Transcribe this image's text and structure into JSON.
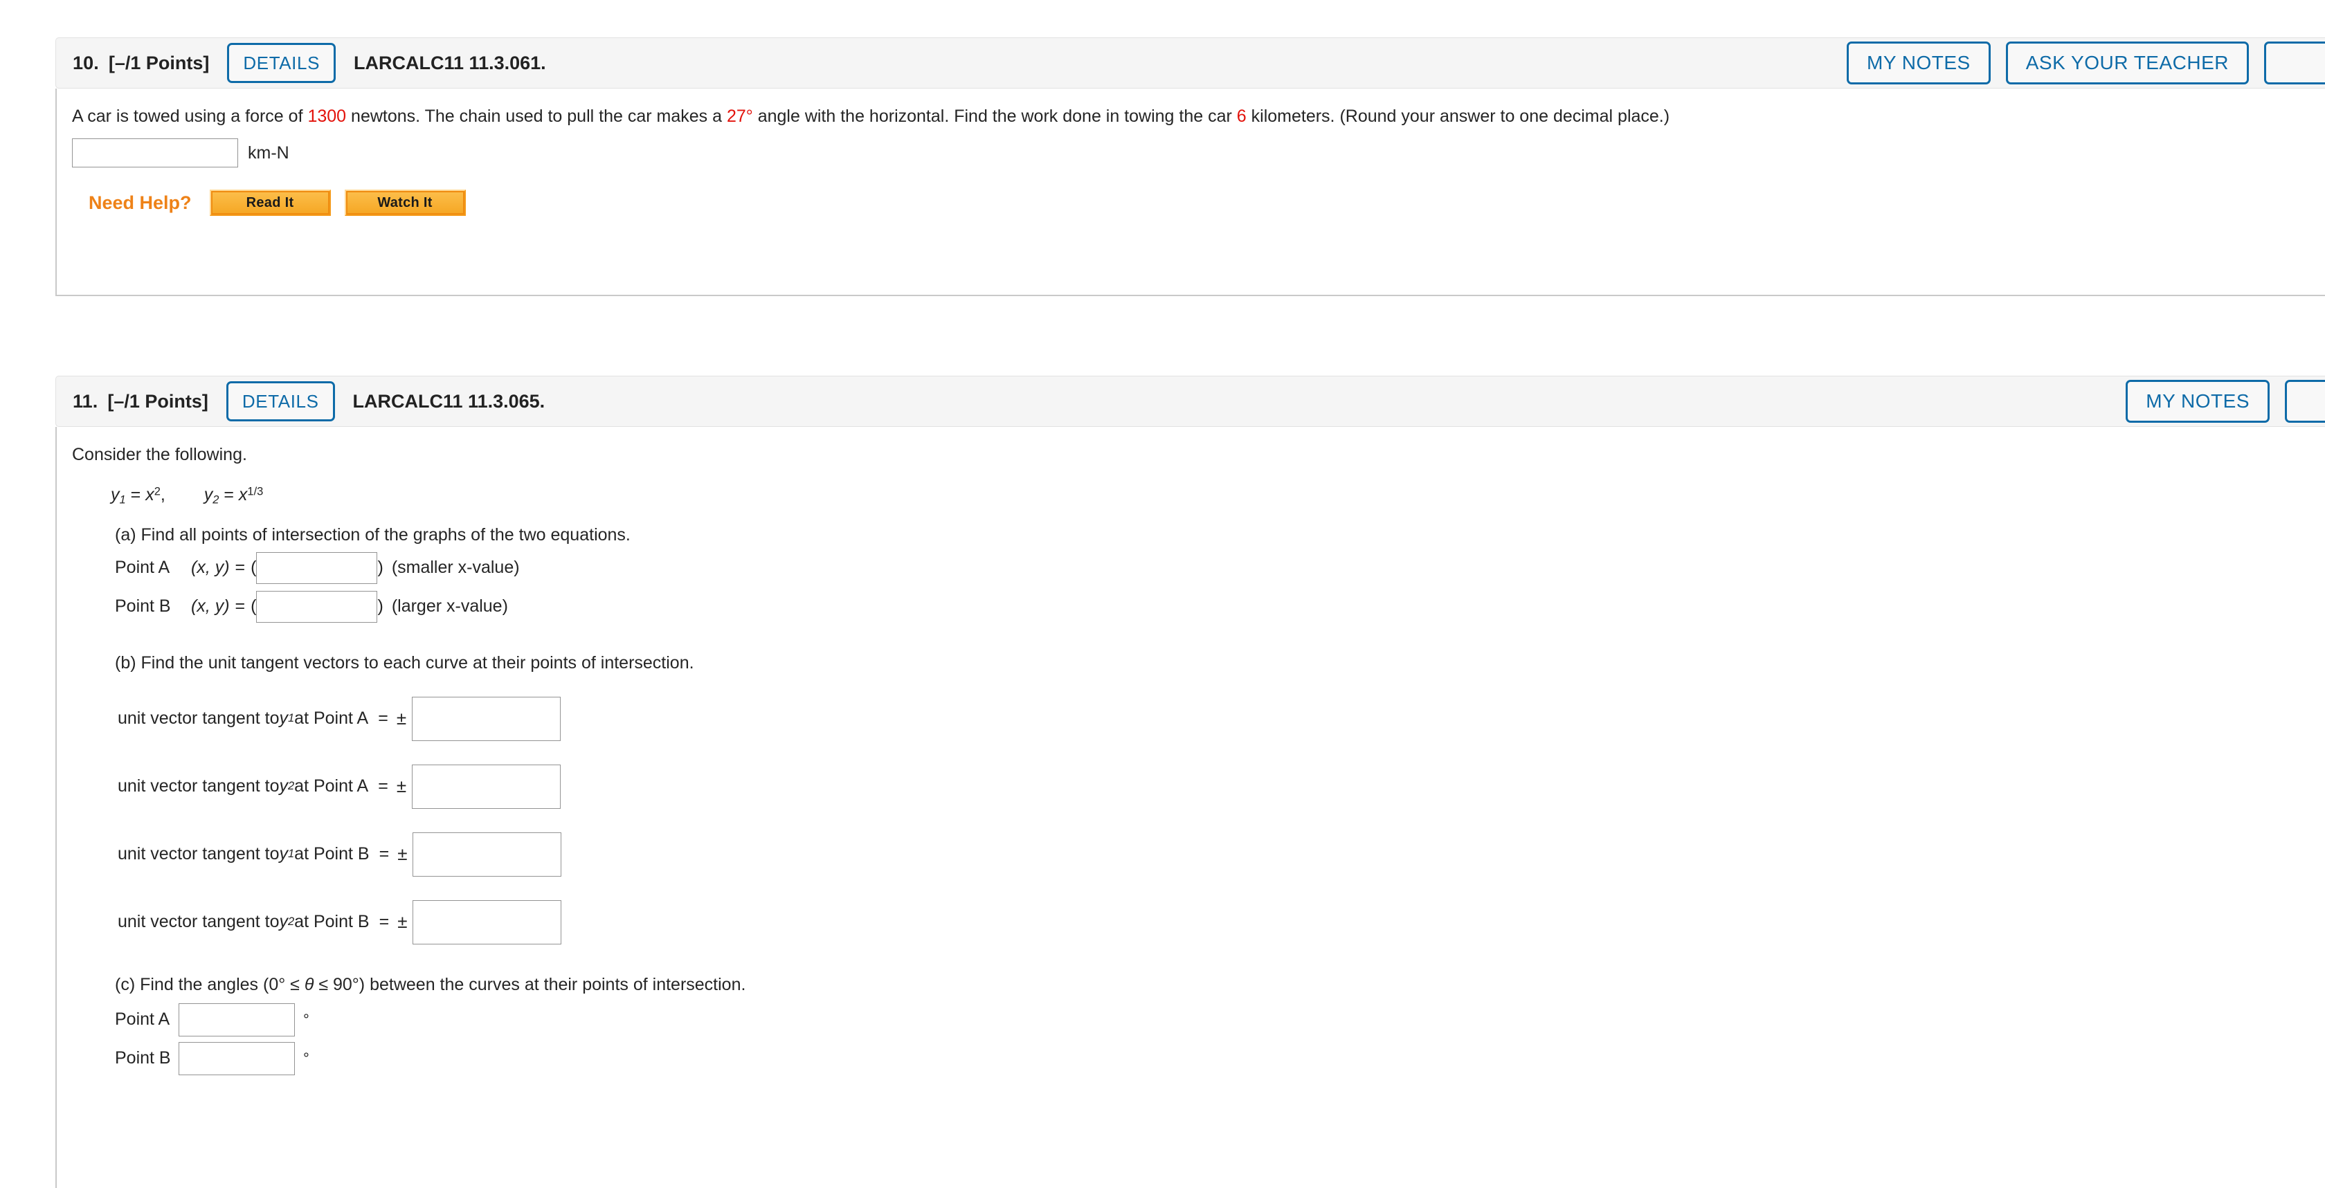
{
  "questions": [
    {
      "number": "10.",
      "points": "[–/1 Points]",
      "details_label": "DETAILS",
      "code": "LARCALC11 11.3.061.",
      "header_buttons": [
        "MY NOTES",
        "ASK YOUR TEACHER"
      ],
      "prompt": {
        "seg1": "A car is towed using a force of ",
        "force": "1300",
        "seg2": " newtons. The chain used to pull the car makes a ",
        "angle": "27°",
        "seg3": " angle with the horizontal. Find the work done in towing the car ",
        "distance": "6",
        "seg4": " kilometers. (Round your answer to one decimal place.)"
      },
      "answer_unit": "km-N",
      "answer_value": "",
      "need_help_label": "Need Help?",
      "help_buttons": [
        "Read It",
        "Watch It"
      ]
    },
    {
      "number": "11.",
      "points": "[–/1 Points]",
      "details_label": "DETAILS",
      "code": "LARCALC11 11.3.065.",
      "header_buttons": [
        "MY NOTES"
      ],
      "intro": "Consider the following.",
      "equations": {
        "y1_lhs": "y",
        "y1_sub": "1",
        "y1_eq": " = ",
        "y1_base": "x",
        "y1_exp": "2",
        "comma": ",",
        "y2_lhs": "y",
        "y2_sub": "2",
        "y2_eq": " = ",
        "y2_base": "x",
        "y2_exp": "1/3"
      },
      "part_a": {
        "label": "(a) Find all points of intersection of the graphs of the two equations.",
        "rows": [
          {
            "name": "Point A",
            "coord": "(x, y)",
            "equals": "=",
            "open": "(",
            "close": ")",
            "value": "",
            "suffix": "(smaller x-value)"
          },
          {
            "name": "Point B",
            "coord": "(x, y)",
            "equals": "=",
            "open": "(",
            "close": ")",
            "value": "",
            "suffix": "(larger x-value)"
          }
        ]
      },
      "part_b": {
        "label": "(b) Find the unit tangent vectors to each curve at their points of intersection.",
        "rows": [
          {
            "prefix": "unit vector tangent to ",
            "y": "y",
            "sub": "1",
            "mid": " at Point A",
            "equals": "=",
            "pm": "±",
            "value": ""
          },
          {
            "prefix": "unit vector tangent to ",
            "y": "y",
            "sub": "2",
            "mid": " at Point A",
            "equals": "=",
            "pm": "±",
            "value": ""
          },
          {
            "prefix": "unit vector tangent to ",
            "y": "y",
            "sub": "1",
            "mid": " at Point B",
            "equals": "=",
            "pm": "±",
            "value": ""
          },
          {
            "prefix": "unit vector tangent to ",
            "y": "y",
            "sub": "2",
            "mid": " at Point B",
            "equals": "=",
            "pm": "±",
            "value": ""
          }
        ]
      },
      "part_c": {
        "label_pre": "(c) Find the angles (0° ≤ ",
        "theta": "θ",
        "label_post": " ≤ 90°) between the curves at their points of intersection.",
        "rows": [
          {
            "name": "Point A",
            "value": "",
            "unit": "°"
          },
          {
            "name": "Point B",
            "value": "",
            "unit": "°"
          }
        ]
      }
    }
  ],
  "colors": {
    "accent_blue": "#0e6ba8",
    "highlight_red": "#e3120b",
    "help_orange": "#ee8218",
    "header_bg": "#f5f5f5"
  }
}
